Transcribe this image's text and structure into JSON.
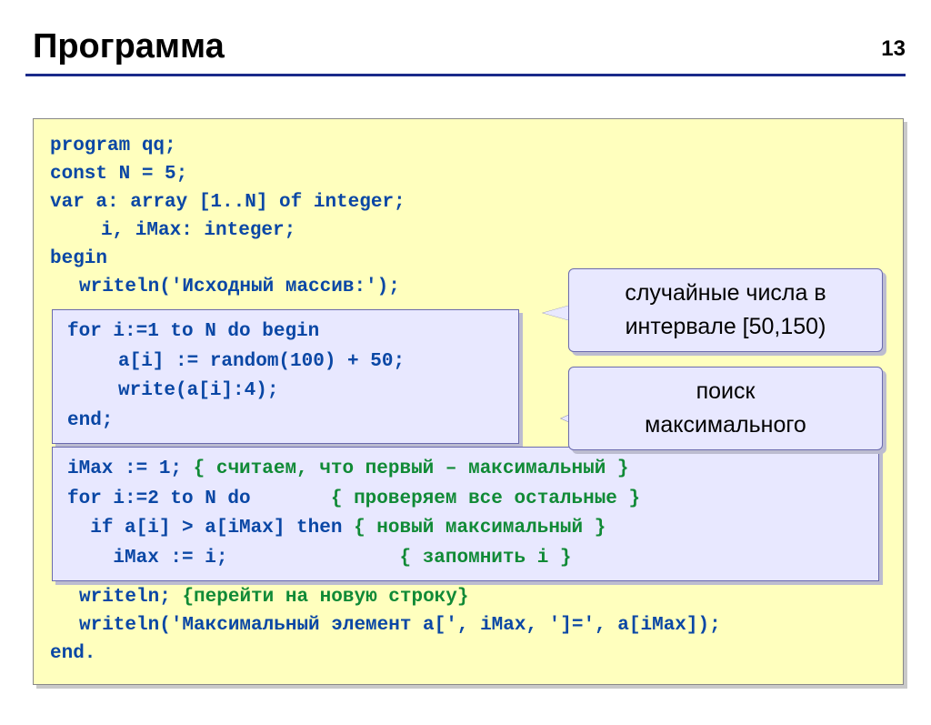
{
  "page_number": "13",
  "title": "Программа",
  "code": {
    "l1": "program qq;",
    "l2": "const N = 5;",
    "l3": "var a: array [1..N] of integer;",
    "l4": "i, iMax: integer;",
    "l5": "begin",
    "l6": "writeln('Исходный массив:');",
    "l11": "writeln;",
    "l11c": "{перейти на новую строку}",
    "l12": "writeln('Максимальный элемент a[', iMax, ']=', a[iMax]);",
    "l13": "end."
  },
  "box1": {
    "l1": "for i:=1 to N do begin",
    "l2": "a[i] := random(100) + 50;",
    "l3": "write(a[i]:4);",
    "l4": "end;"
  },
  "box2": {
    "l1": "iMax := 1;",
    "l1c": "{ считаем, что первый – максимальный }",
    "l2": "for i:=2 to N do",
    "l2c": "{ проверяем все остальные }",
    "l3": "if a[i] > a[iMax] then",
    "l3c": "{ новый максимальный }",
    "l4": "iMax := i;",
    "l4c": "{ запомнить i }"
  },
  "callout1_l1": "случайные числа в",
  "callout1_l2": "интервале [50,150)",
  "callout2_l1": "поиск",
  "callout2_l2": "максимального"
}
